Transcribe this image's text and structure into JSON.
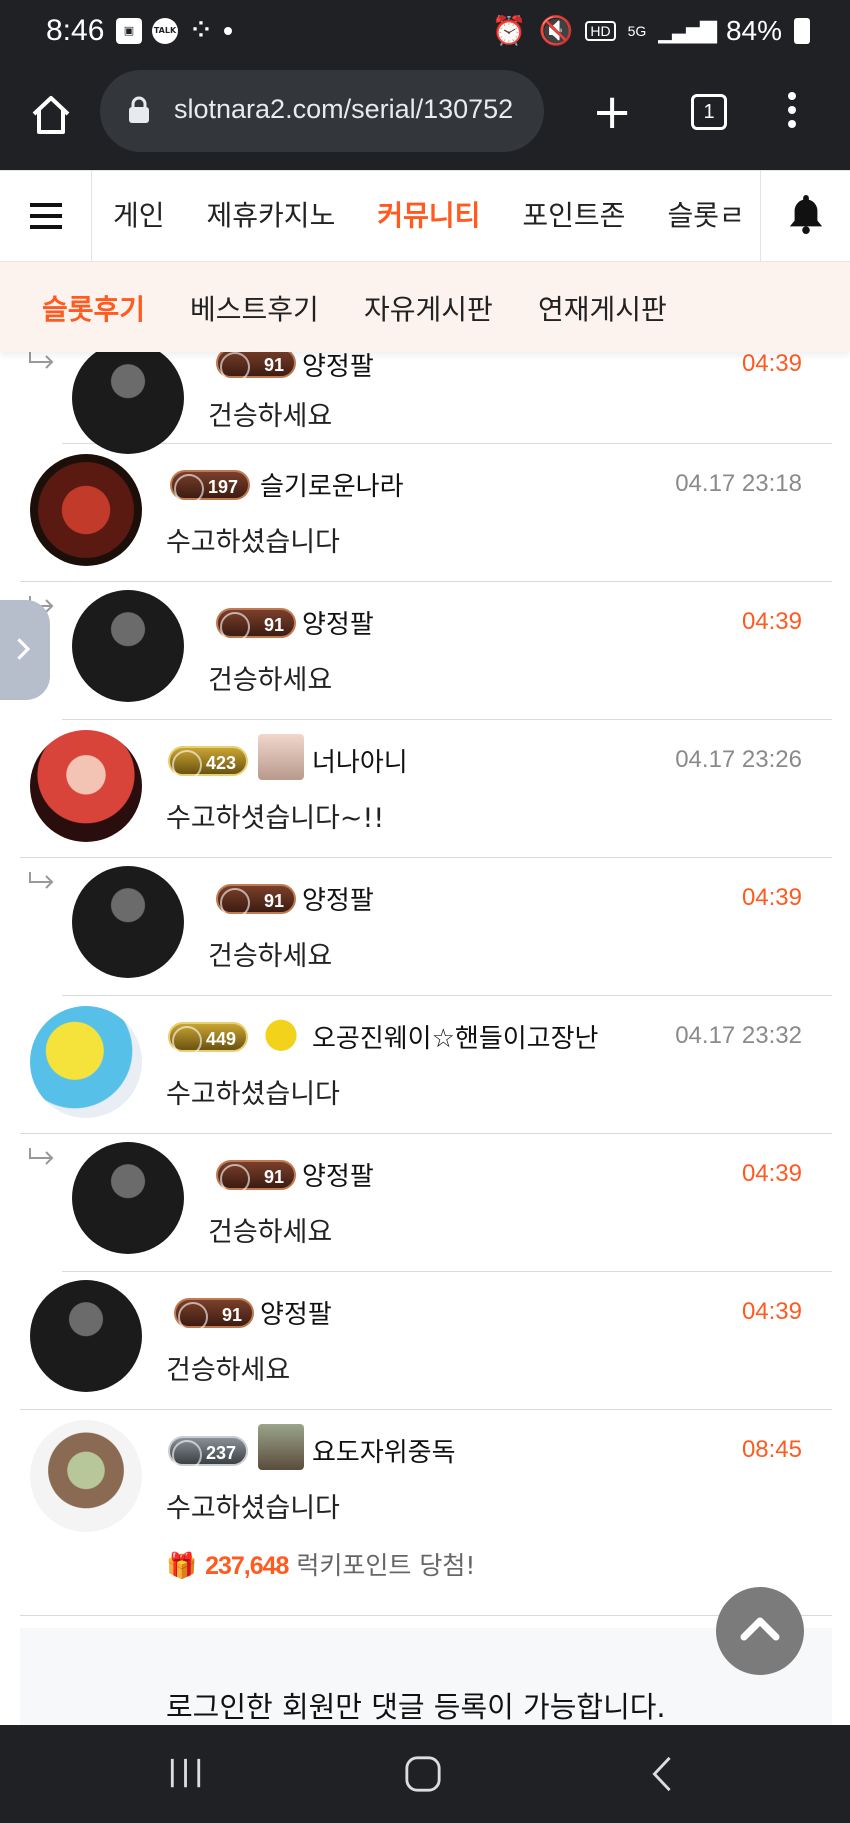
{
  "status_bar": {
    "time": "8:46",
    "talk_badge": "TALK",
    "battery": "84%",
    "hd_badge": "HD",
    "net_badge": "5G"
  },
  "browser": {
    "url": "slotnara2.com/serial/130752",
    "tab_count": "1"
  },
  "main_nav": {
    "items": [
      "게인",
      "제휴카지노",
      "커뮤니티",
      "포인트존",
      "슬롯ㄹ"
    ],
    "active": "커뮤니티"
  },
  "sub_nav": {
    "items": [
      "슬롯후기",
      "베스트후기",
      "자유게시판",
      "연재게시판"
    ],
    "active": "슬롯후기"
  },
  "comments": [
    {
      "nick": "양정팔",
      "level": "91",
      "time": "04:39",
      "text": "건승하세요",
      "reply": true,
      "partial": true
    },
    {
      "nick": "슬기로운나라",
      "level": "197",
      "time": "04.17 23:18",
      "text": "수고하셨습니다",
      "reply": false
    },
    {
      "nick": "양정팔",
      "level": "91",
      "time": "04:39",
      "text": "건승하세요",
      "reply": true
    },
    {
      "nick": "너나아니",
      "level": "423",
      "time": "04.17 23:26",
      "text": "수고하셧습니다~!!",
      "reply": false
    },
    {
      "nick": "양정팔",
      "level": "91",
      "time": "04:39",
      "text": "건승하세요",
      "reply": true
    },
    {
      "nick": "오공진웨이☆핸들이고장난",
      "level": "449",
      "time": "04.17 23:32",
      "text": "수고하셨습니다",
      "reply": false
    },
    {
      "nick": "양정팔",
      "level": "91",
      "time": "04:39",
      "text": "건승하세요",
      "reply": true
    },
    {
      "nick": "양정팔",
      "level": "91",
      "time": "04:39",
      "text": "건승하세요",
      "reply": false
    },
    {
      "nick": "요도자위중독",
      "level": "237",
      "time": "08:45",
      "text": "수고하셨습니다",
      "reply": false
    }
  ],
  "lucky_point": {
    "points": "237,648",
    "label": "럭키포인트 당첨!"
  },
  "login_notice": "로그인한 회원만 댓글 등록이 가능합니다.",
  "colors": {
    "accent": "#ff5a1f",
    "chrome_bg": "#1f2125",
    "sub_nav_bg": "#fcf3ef",
    "time_gray": "#8a8a8a"
  }
}
